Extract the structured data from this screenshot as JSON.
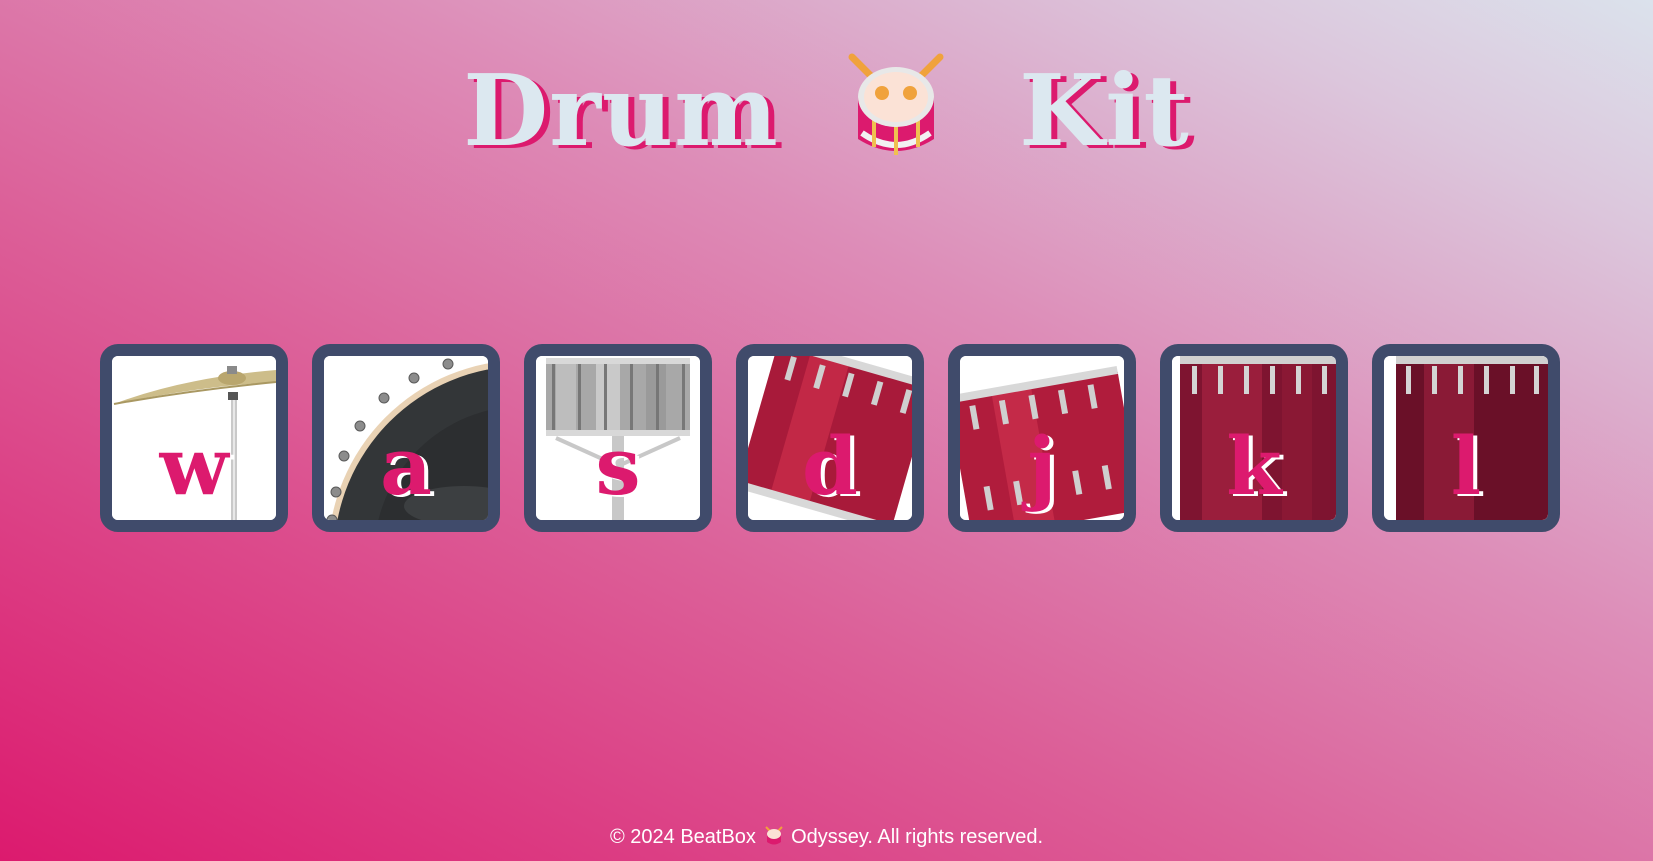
{
  "header": {
    "title_left": "Drum",
    "title_icon": "drum-emoji",
    "title_right": "Kit"
  },
  "drums": [
    {
      "key": "w",
      "instrument_icon": "crash-cymbal-icon"
    },
    {
      "key": "a",
      "instrument_icon": "kick-drum-icon"
    },
    {
      "key": "s",
      "instrument_icon": "snare-drum-icon"
    },
    {
      "key": "d",
      "instrument_icon": "tom-1-icon"
    },
    {
      "key": "j",
      "instrument_icon": "tom-2-icon"
    },
    {
      "key": "k",
      "instrument_icon": "tom-3-icon"
    },
    {
      "key": "l",
      "instrument_icon": "tom-4-icon"
    }
  ],
  "footer": {
    "text_before": "© 2024 BeatBox",
    "icon": "drum-emoji",
    "text_after": "Odyssey. All rights reserved."
  },
  "colors": {
    "accent": "#dc1a6e",
    "title_text": "#dce8f0",
    "drum_border": "#404b6b",
    "gradient_start": "#dc1a6e",
    "gradient_end": "#dbe2ec"
  }
}
